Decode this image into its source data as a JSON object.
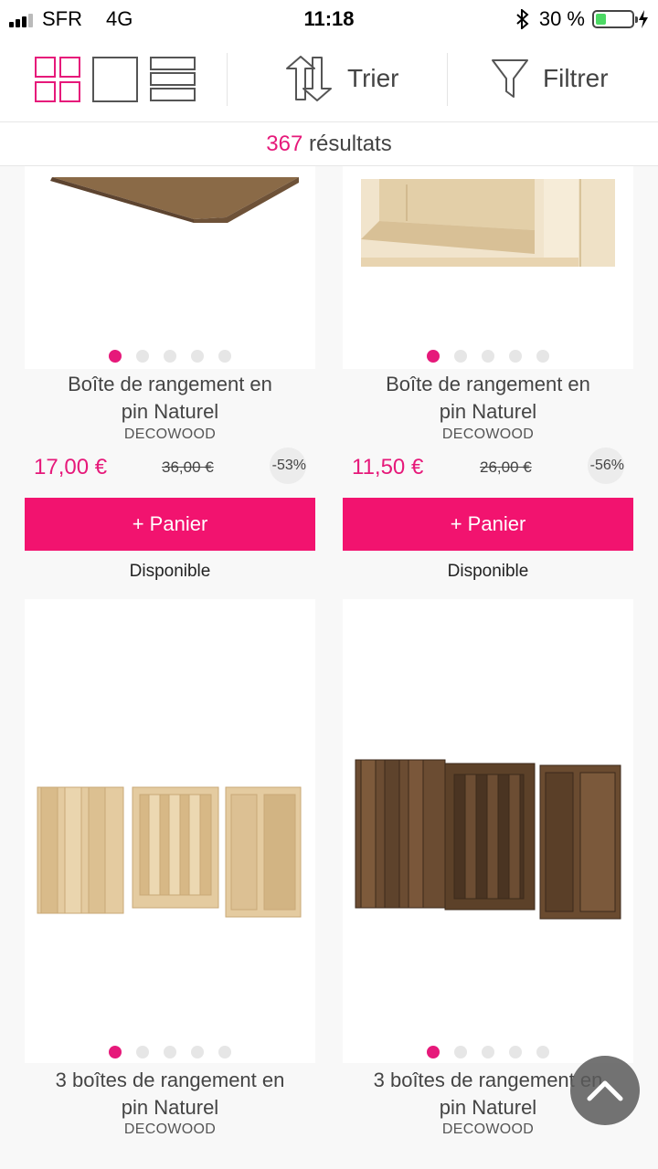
{
  "status_bar": {
    "carrier": "SFR",
    "network": "4G",
    "time": "11:18",
    "battery": "30 %",
    "battery_level": 0.3
  },
  "toolbar": {
    "sort_label": "Trier",
    "filter_label": "Filtrer"
  },
  "results": {
    "count": "367",
    "label": "résultats"
  },
  "products": [
    {
      "title_line1": "Boîte de rangement en",
      "title_line2": "pin Naturel",
      "brand": "DECOWOOD",
      "price": "17,00 €",
      "old_price": "36,00 €",
      "discount": "-53%",
      "button": "+ Panier",
      "stock": "Disponible"
    },
    {
      "title_line1": "Boîte de rangement en",
      "title_line2": "pin Naturel",
      "brand": "DECOWOOD",
      "price": "11,50 €",
      "old_price": "26,00 €",
      "discount": "-56%",
      "button": "+ Panier",
      "stock": "Disponible"
    },
    {
      "title_line1": "3 boîtes de rangement en",
      "title_line2": "pin Naturel",
      "brand": "DECOWOOD"
    },
    {
      "title_line1": "3 boîtes de rangement en",
      "title_line2": "pin Naturel",
      "brand": "DECOWOOD"
    }
  ],
  "colors": {
    "accent": "#e6197a",
    "button": "#f2136f",
    "battery": "#4cd964"
  }
}
